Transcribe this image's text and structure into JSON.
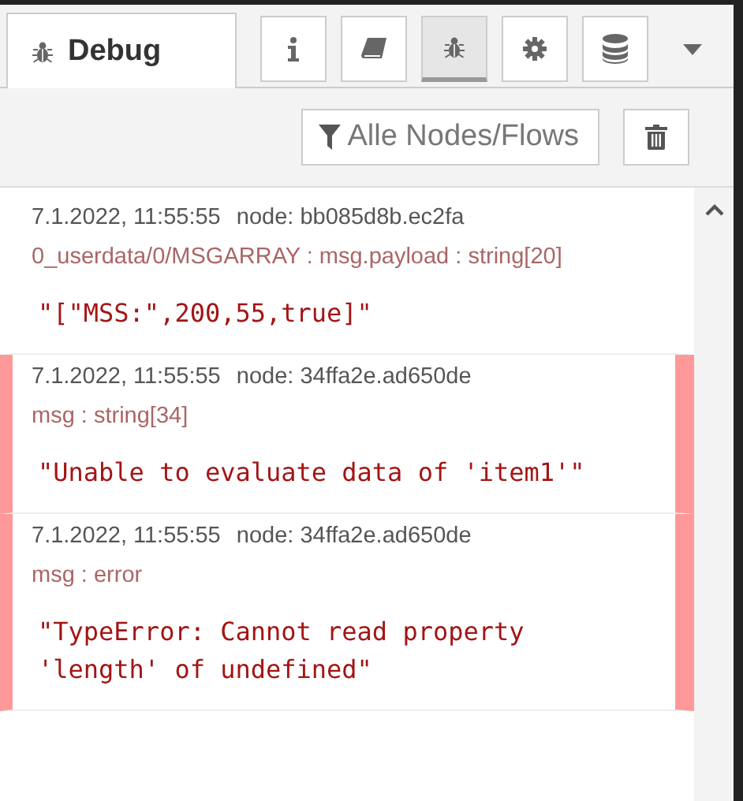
{
  "tab": {
    "label": "Debug",
    "selected": true
  },
  "tool_buttons": [
    {
      "kind": "info",
      "selected": false
    },
    {
      "kind": "book",
      "selected": false
    },
    {
      "kind": "bug",
      "selected": true
    },
    {
      "kind": "gear",
      "selected": false
    },
    {
      "kind": "database",
      "selected": false
    }
  ],
  "filter_button": {
    "label": "Alle Nodes/Flows"
  },
  "messages": [
    {
      "time": "7.1.2022, 11:55:55",
      "node": "node: bb085d8b.ec2fa",
      "topic": "0_userdata/0/MSGARRAY : msg.payload : string[20]",
      "payload": "\"[\"MSS:\",200,55,true]\"",
      "error": false
    },
    {
      "time": "7.1.2022, 11:55:55",
      "node": "node: 34ffa2e.ad650de",
      "topic": "msg : string[34]",
      "payload": "\"Unable to evaluate data of 'item1'\"",
      "error": true
    },
    {
      "time": "7.1.2022, 11:55:55",
      "node": "node: 34ffa2e.ad650de",
      "topic": "msg : error",
      "payload": "\"TypeError: Cannot read property 'length' of undefined\"",
      "error": true
    }
  ]
}
